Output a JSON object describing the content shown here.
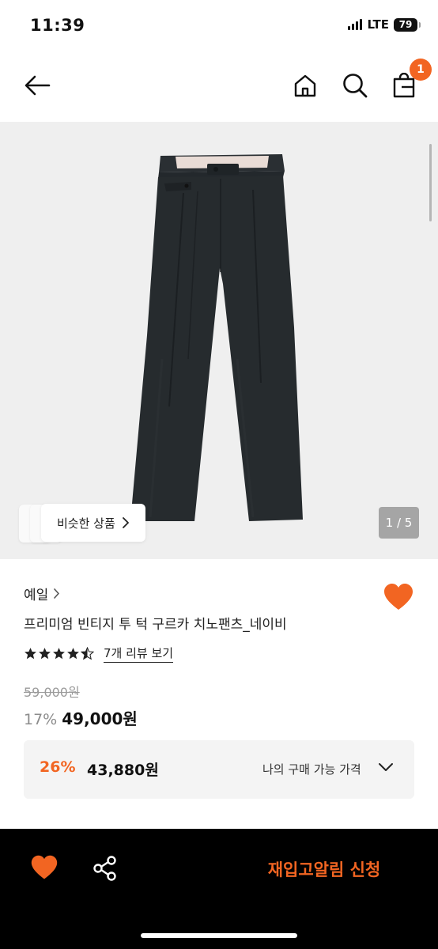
{
  "status_bar": {
    "time": "11:39",
    "network": "LTE",
    "battery": "79"
  },
  "nav": {
    "cart_count": "1",
    "icons": [
      "back-arrow-icon",
      "home-icon",
      "search-icon",
      "shopping-bag-icon"
    ]
  },
  "gallery": {
    "similar_label": "비슷한 상품",
    "page_counter": "1 / 5"
  },
  "product": {
    "brand": "예일",
    "title": "프리미엄 빈티지 투 턱 구르카 치노팬츠_네이비",
    "rating": 4.5,
    "review_link": "7개 리뷰 보기",
    "original_price": "59,000원",
    "discount_rate": "17%",
    "price": "49,000원",
    "liked": true
  },
  "purchase_box": {
    "discount_rate": "26%",
    "price": "43,880원",
    "label": "나의 구매 가능 가격"
  },
  "bottom_bar": {
    "restock_label": "재입고알림 신청"
  },
  "colors": {
    "accent": "#f26522",
    "bottom_bar": "#000000",
    "image_bg": "#efefef",
    "pants": "#262b2e"
  }
}
